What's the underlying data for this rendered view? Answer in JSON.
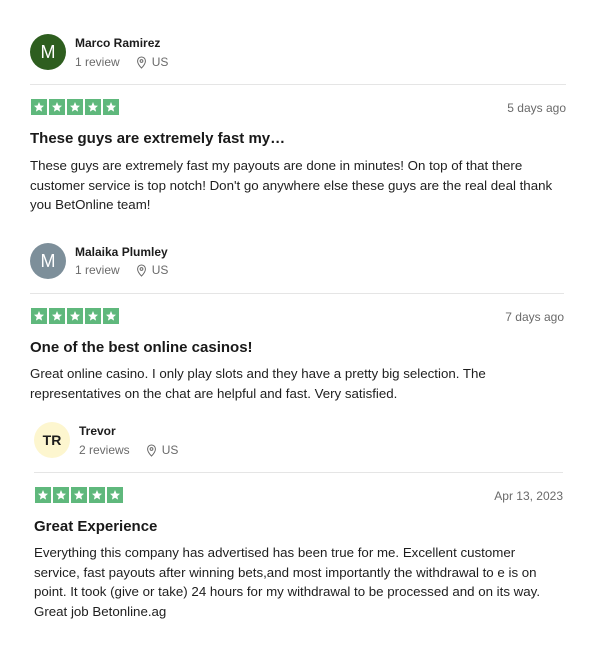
{
  "reviews": [
    {
      "avatar_text": "M",
      "avatar_bg": "#2e5e1f",
      "avatar_fg": "#ffffff",
      "name": "Marco Ramirez",
      "review_count": "1 review",
      "country": "US",
      "rating": 5,
      "date": "5 days ago",
      "title": "These guys are extremely fast my…",
      "body": "These guys are extremely fast my payouts are done in minutes! On top of that there customer service is top notch! Don't go anywhere else these guys are the real deal thank you BetOnline team!"
    },
    {
      "avatar_text": "M",
      "avatar_bg": "#7d8f9a",
      "avatar_fg": "#ffffff",
      "name": "Malaika Plumley",
      "review_count": "1 review",
      "country": "US",
      "rating": 5,
      "date": "7 days ago",
      "title": "One of the best online casinos!",
      "body": "Great online casino. I only play slots and they have a pretty big selection. The representatives on the chat are helpful and fast. Very satisfied."
    },
    {
      "avatar_text": "TR",
      "avatar_bg": "#fdf6cf",
      "avatar_fg": "#1c1c1c",
      "name": "Trevor",
      "review_count": "2 reviews",
      "country": "US",
      "rating": 5,
      "date": "Apr 13, 2023",
      "title": "Great Experience",
      "body": "Everything this company has advertised has been true for me. Excellent customer service, fast payouts after winning bets,and most importantly the withdrawal to e is on point. It took (give or take) 24 hours for my withdrawal to be processed and on its way. Great job Betonline.ag"
    }
  ],
  "colors": {
    "star_fill": "#5fb87c",
    "star_glyph": "#ffffff"
  },
  "icons": {
    "star": "star-icon",
    "location": "location-pin-icon"
  }
}
